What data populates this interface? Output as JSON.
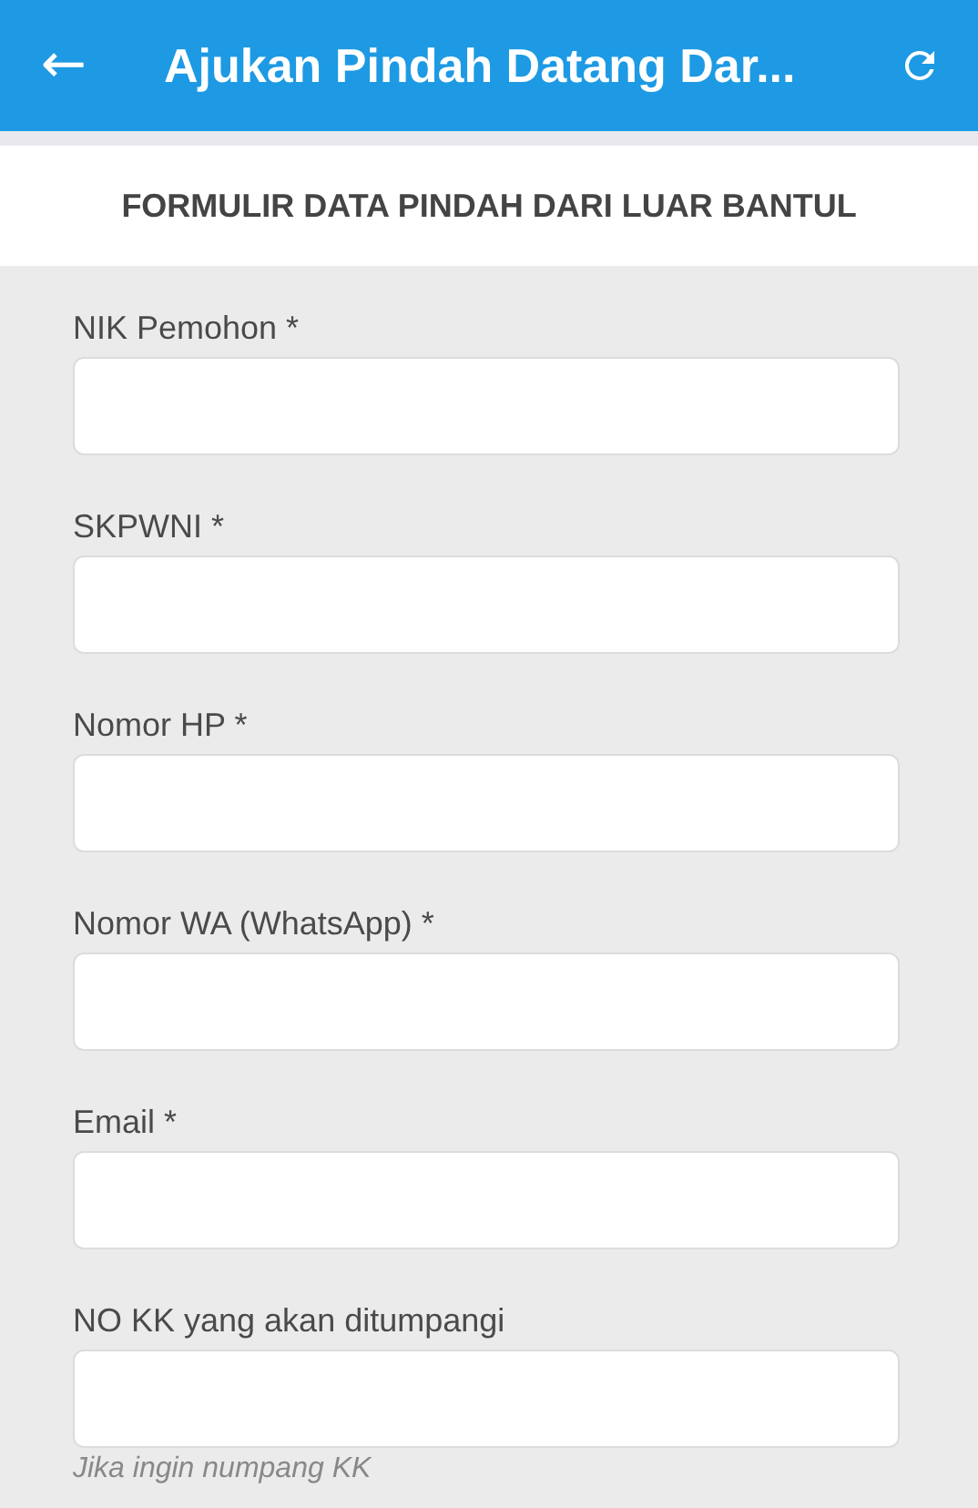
{
  "app_bar": {
    "back_icon": "←",
    "title": "Ajukan Pindah Datang Dar..."
  },
  "section_title": "FORMULIR DATA PINDAH DARI LUAR BANTUL",
  "fields": [
    {
      "label": "NIK Pemohon *"
    },
    {
      "label": "SKPWNI *"
    },
    {
      "label": "Nomor HP *"
    },
    {
      "label": "Nomor WA (WhatsApp) *"
    },
    {
      "label": "Email *"
    },
    {
      "label": "NO KK yang akan ditumpangi",
      "hint": "Jika ingin numpang KK"
    }
  ]
}
